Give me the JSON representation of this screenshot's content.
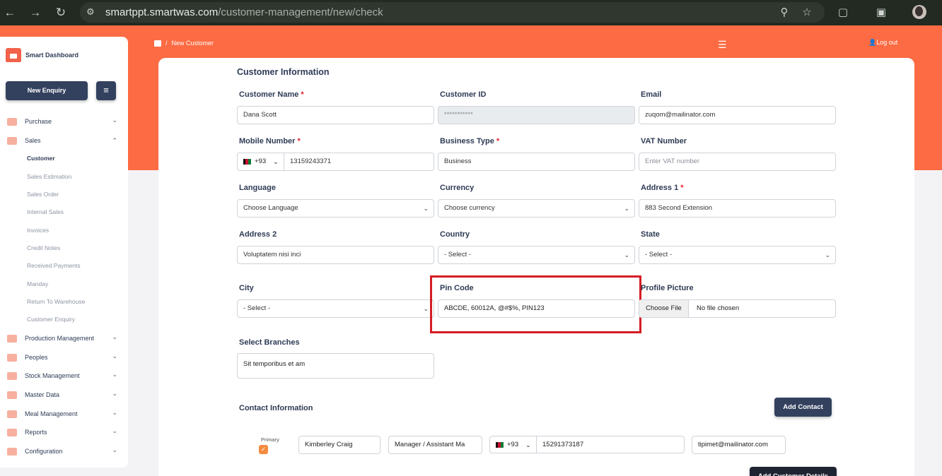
{
  "browser": {
    "url_host": "smartppt.smartwas.com",
    "url_path": "/customer-management/new/check"
  },
  "sidebar": {
    "brand": "Smart Dashboard",
    "new_enquiry": "New Enquiry",
    "items": [
      {
        "label": "Purchase"
      },
      {
        "label": "Sales"
      },
      {
        "label": "Production Management"
      },
      {
        "label": "Peoples"
      },
      {
        "label": "Stock Management"
      },
      {
        "label": "Master Data"
      },
      {
        "label": "Meal Management"
      },
      {
        "label": "Reports"
      },
      {
        "label": "Configuration"
      }
    ],
    "sales_sub": [
      {
        "label": "Customer"
      },
      {
        "label": "Sales Estimation"
      },
      {
        "label": "Sales Order"
      },
      {
        "label": "Internal Sales"
      },
      {
        "label": "Invoices"
      },
      {
        "label": "Credit Notes"
      },
      {
        "label": "Received Payments"
      },
      {
        "label": "Manday"
      },
      {
        "label": "Return To Warehouse"
      },
      {
        "label": "Customer Enquiry"
      }
    ]
  },
  "header": {
    "breadcrumb_sep": "/",
    "breadcrumb": "New Customer",
    "logout": "Log out"
  },
  "form": {
    "title": "Customer Information",
    "customer_name": {
      "label": "Customer Name",
      "value": "Dana Scott"
    },
    "customer_id": {
      "label": "Customer ID",
      "value": "***********"
    },
    "email": {
      "label": "Email",
      "value": "zuqom@mailinator.com"
    },
    "mobile": {
      "label": "Mobile Number",
      "code": "+93",
      "value": "13159243371"
    },
    "business_type": {
      "label": "Business Type",
      "value": "Business"
    },
    "vat": {
      "label": "VAT Number",
      "placeholder": "Enter VAT number"
    },
    "language": {
      "label": "Language",
      "value": "Choose Language"
    },
    "currency": {
      "label": "Currency",
      "value": "Choose currency"
    },
    "address1": {
      "label": "Address 1",
      "value": "883 Second Extension"
    },
    "address2": {
      "label": "Address 2",
      "value": "Voluptatem nisi inci"
    },
    "country": {
      "label": "Country",
      "value": "- Select -"
    },
    "state": {
      "label": "State",
      "value": "- Select -"
    },
    "city": {
      "label": "City",
      "value": "- Select -"
    },
    "pin": {
      "label": "Pin Code",
      "value": "ABCDE, 60012A, @#$%, PIN123"
    },
    "profile": {
      "label": "Profile Picture",
      "button": "Choose File",
      "status": "No file chosen"
    },
    "branches": {
      "label": "Select Branches",
      "value": "Sit temporibus et am"
    },
    "req_mark": "*"
  },
  "contact": {
    "title": "Contact Information",
    "add_button": "Add Contact",
    "primary_label": "Primary",
    "name": "Kimberley Craig",
    "designation": "Manager / Assistant Ma",
    "code": "+93",
    "phone": "15291373187",
    "email": "tipimet@mailinator.com",
    "add_details_button": "Add Customer Details"
  },
  "colors": {
    "accent": "#fc6b43",
    "navy": "#33415e",
    "highlight": "#d41d24"
  }
}
